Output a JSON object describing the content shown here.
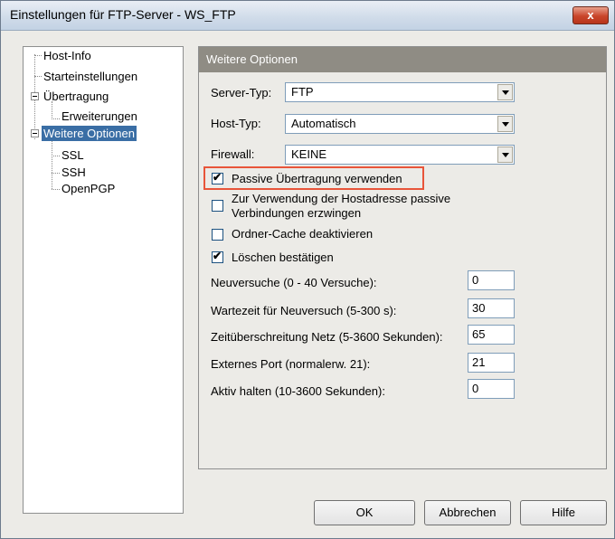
{
  "window": {
    "title": "Einstellungen für FTP-Server - WS_FTP",
    "close_label": "x"
  },
  "tree": {
    "items": [
      {
        "label": "Host-Info"
      },
      {
        "label": "Starteinstellungen"
      },
      {
        "label": "Übertragung"
      },
      {
        "label": "Erweiterungen"
      },
      {
        "label": "Weitere Optionen",
        "selected": true
      },
      {
        "label": "SSL"
      },
      {
        "label": "SSH"
      },
      {
        "label": "OpenPGP"
      }
    ]
  },
  "panel": {
    "header": "Weitere Optionen",
    "server_type": {
      "label": "Server-Typ:",
      "value": "FTP"
    },
    "host_type": {
      "label": "Host-Typ:",
      "value": "Automatisch"
    },
    "firewall": {
      "label": "Firewall:",
      "value": "KEINE"
    },
    "checkboxes": [
      {
        "label": "Passive Übertragung verwenden",
        "checked": true
      },
      {
        "label_line1": "Zur Verwendung der Hostadresse passive",
        "label_line2": "Verbindungen erzwingen",
        "checked": false
      },
      {
        "label": "Ordner-Cache deaktivieren",
        "checked": false
      },
      {
        "label": "Löschen bestätigen",
        "checked": true
      }
    ],
    "fields": [
      {
        "label": "Neuversuche (0 - 40 Versuche):",
        "value": "0"
      },
      {
        "label": "Wartezeit für Neuversuch (5-300 s):",
        "value": "30"
      },
      {
        "label": "Zeitüberschreitung Netz (5-3600 Sekunden):",
        "value": "65"
      },
      {
        "label": "Externes Port (normalerw. 21):",
        "value": "21"
      },
      {
        "label": "Aktiv halten (10-3600 Sekunden):",
        "value": "0"
      }
    ]
  },
  "buttons": {
    "ok": "OK",
    "cancel": "Abbrechen",
    "help": "Hilfe"
  }
}
